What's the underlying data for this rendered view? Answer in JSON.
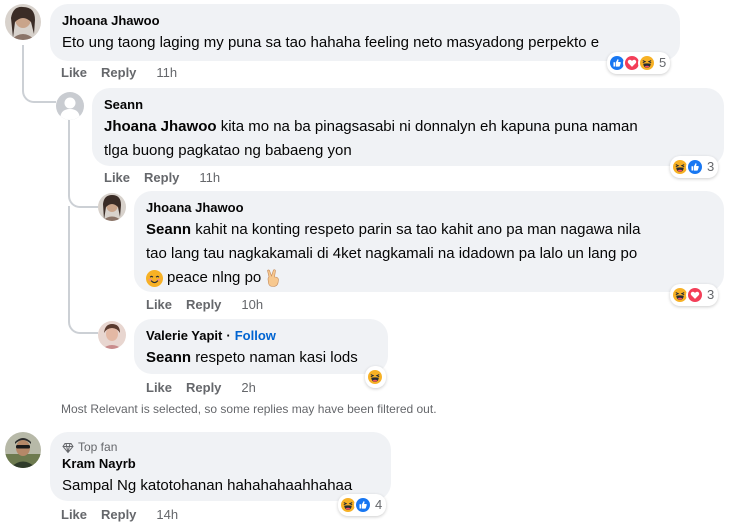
{
  "comments": [
    {
      "author": "Jhoana Jhawoo",
      "text": "Eto ung taong laging my puna sa tao hahaha feeling neto masyadong perpekto e",
      "like": "Like",
      "reply": "Reply",
      "time": "11h",
      "reactions": [
        "like",
        "love",
        "haha"
      ],
      "reaction_count": "5"
    },
    {
      "author": "Seann",
      "mention": "Jhoana Jhawoo",
      "text_line1": "kita mo na ba pinagsasabi ni donnalyn eh kapuna puna naman",
      "text_line2": "tlga buong pagkatao ng babaeng yon",
      "like": "Like",
      "reply": "Reply",
      "time": "11h",
      "reactions": [
        "haha",
        "like"
      ],
      "reaction_count": "3"
    },
    {
      "author": "Jhoana Jhawoo",
      "mention": "Seann",
      "text_line1": "kahit na konting respeto parin sa tao kahit ano pa man nagawa nila",
      "text_line2": "tao lang tau nagkakamali di 4ket nagkamali na idadown pa lalo un lang po",
      "text_line3": "peace nlng po",
      "like": "Like",
      "reply": "Reply",
      "time": "10h",
      "reactions": [
        "haha",
        "love"
      ],
      "reaction_count": "3"
    },
    {
      "author": "Valerie Yapit",
      "separator": "·",
      "follow": "Follow",
      "mention": "Seann",
      "text": "respeto naman kasi lods",
      "like": "Like",
      "reply": "Reply",
      "time": "2h",
      "reactions": [
        "haha"
      ]
    },
    {
      "badge": "Top fan",
      "author": "Kram Nayrb",
      "text": "Sampal Ng katotohanan hahahahaahhahaa",
      "like": "Like",
      "reply": "Reply",
      "time": "14h",
      "reactions": [
        "haha",
        "like"
      ],
      "reaction_count": "4"
    }
  ],
  "filter_note": "Most Relevant is selected, so some replies may have been filtered out.",
  "colors": {
    "bubble": "#f0f2f5",
    "secondary_text": "#65676b",
    "follow": "#0064d1",
    "like_blue": "#1877f2",
    "love_red": "#f33e58",
    "haha_yellow": "#f7b125"
  }
}
